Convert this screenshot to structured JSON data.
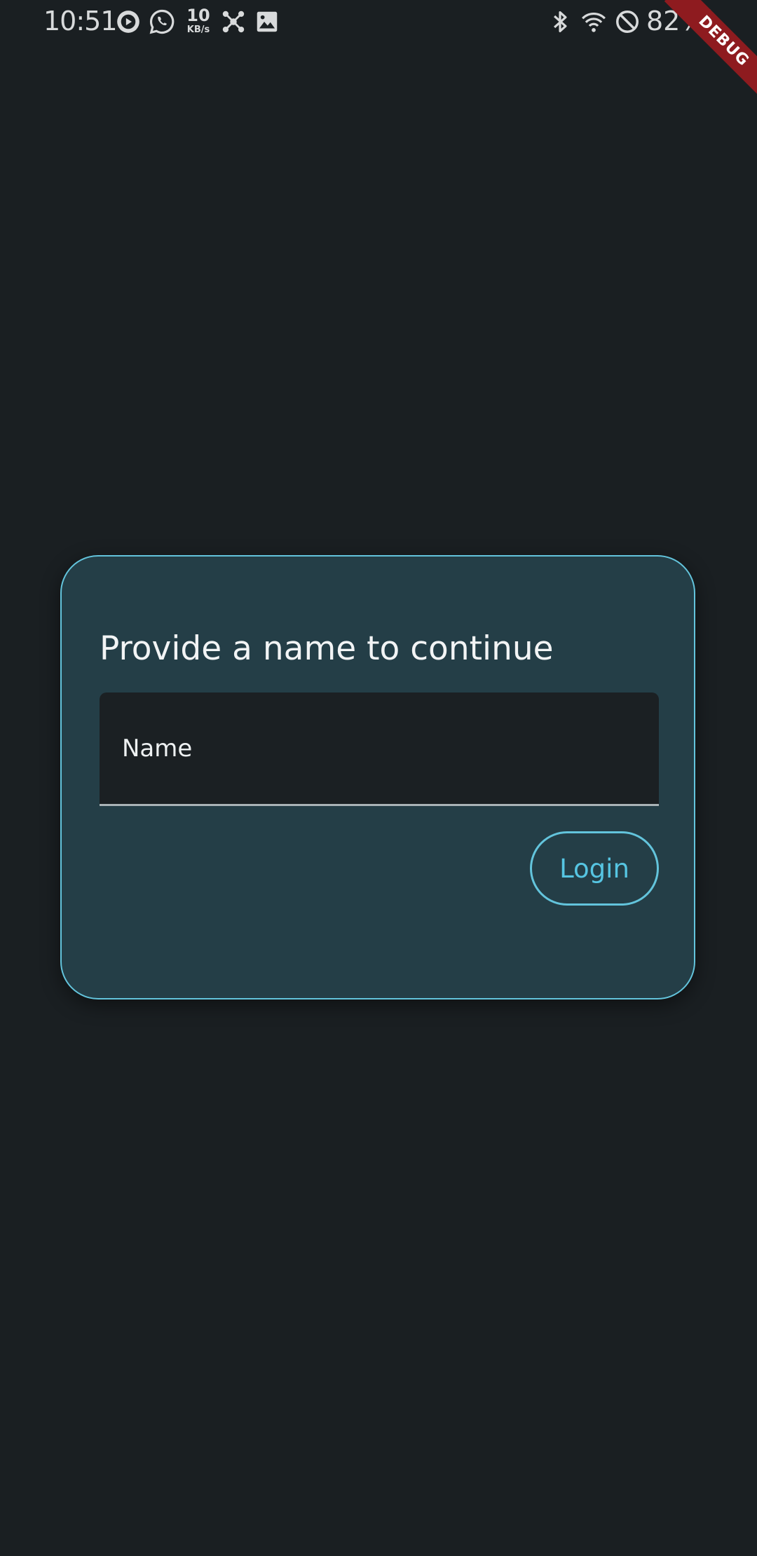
{
  "status_bar": {
    "time": "10:51",
    "net_speed_value": "10",
    "net_speed_unit": "KB/s",
    "battery_percent": "82%",
    "icons": [
      "play-circle-icon",
      "whatsapp-icon",
      "network-speed-icon",
      "hub-icon",
      "image-icon",
      "bluetooth-icon",
      "wifi-icon",
      "do-not-disturb-icon",
      "battery-icon"
    ]
  },
  "debug_banner": {
    "label": "DEBUG",
    "color": "#8e1b1f"
  },
  "login_card": {
    "title": "Provide a name to continue",
    "name_field": {
      "placeholder": "Name",
      "value": ""
    },
    "login_button_label": "Login",
    "accent_color": "#63c4dc"
  }
}
